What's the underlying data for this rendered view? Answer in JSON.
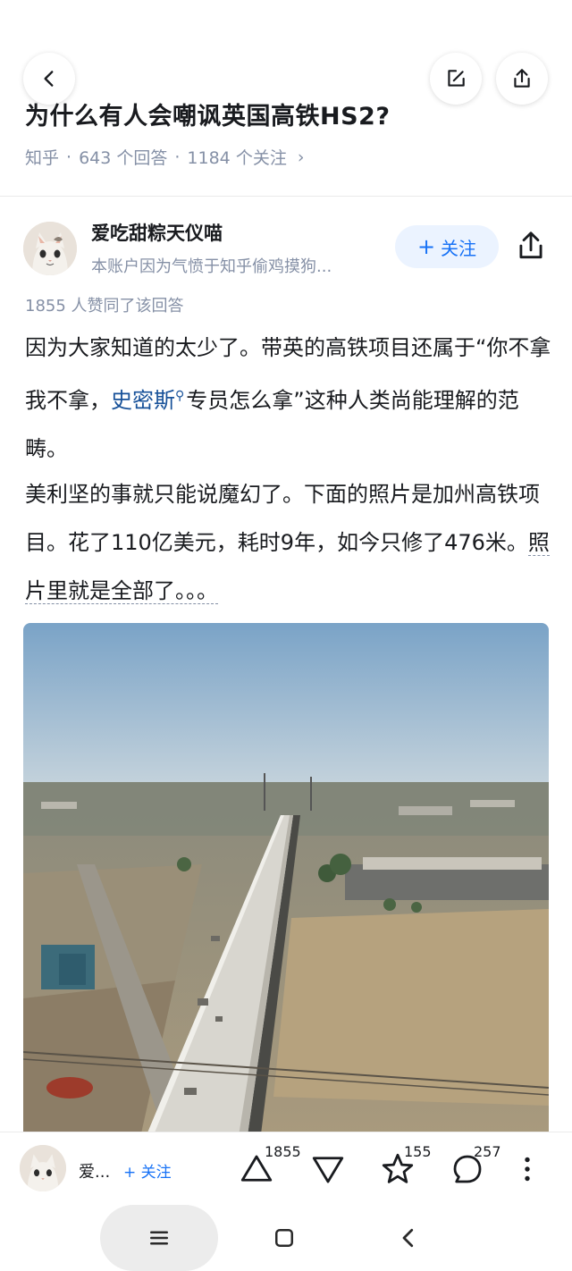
{
  "header": {
    "back_icon": "chevron-left-icon",
    "edit_icon": "edit-icon",
    "share_icon": "share-icon"
  },
  "question": {
    "title": "为什么有人会嘲讽英国高铁HS2?",
    "source": "知乎",
    "answers": "643 个回答",
    "followers": "1184 个关注",
    "separator": "·",
    "more": "›"
  },
  "author": {
    "name": "爱吃甜粽天仪喵",
    "bio": "本账户因为气愤于知乎偷鸡摸狗...",
    "follow_label": "关注",
    "follow_plus": "+"
  },
  "answer": {
    "likes_text": "1855 人赞同了该回答",
    "p1_a": "因为大家知道的太少了。带英的高铁项目还属于“你不拿我不拿，",
    "p1_link": "史密斯",
    "p1_b": "专员怎么拿”这种人类尚能理解的范畴。",
    "p2_a": "美利坚的事就只能说魔幻了。下面的照片是加州高铁项目。花了110亿美元，耗时9年，如今只修了476米。",
    "p2_dashed": "照片里就是全部了。。。"
  },
  "bottom_bar": {
    "author_short": "爱...",
    "follow_label": "+ 关注",
    "upvote_count": "1855",
    "favorite_count": "155",
    "comment_count": "257",
    "icons": [
      "upvote-icon",
      "downvote-icon",
      "star-icon",
      "comment-icon",
      "more-icon"
    ]
  },
  "colors": {
    "accent": "#1772f6",
    "link": "#175199",
    "meta": "#8590a6",
    "text": "#191b1f"
  }
}
